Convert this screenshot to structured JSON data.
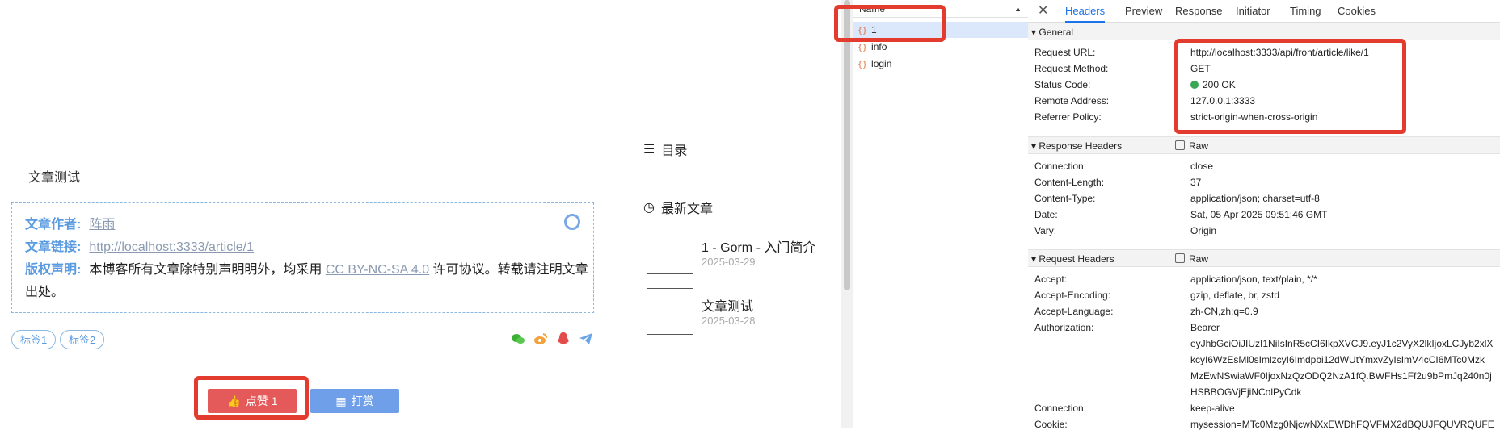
{
  "blog": {
    "article_title": "文章测试",
    "author_label": "文章作者:",
    "author_name": "阵雨",
    "link_label": "文章链接:",
    "link_url": "http://localhost:3333/article/1",
    "copyright_label": "版权声明:",
    "copyright_text_1": "本博客所有文章除特别声明明外，均采用",
    "license": "CC BY-NC-SA 4.0",
    "copyright_text_2": "许可协议。转载请注明文章",
    "copyright_text_3": "出处。",
    "tags": [
      "标签1",
      "标签2"
    ],
    "share_icons": [
      "wechat-icon",
      "weibo-icon",
      "qq-icon",
      "telegram-icon"
    ],
    "like_button": "点赞 1",
    "reward_button": "打赏"
  },
  "sidebar": {
    "toc_title": "目录",
    "recent_title": "最新文章",
    "recent_posts": [
      {
        "title": "1 - Gorm - 入门简介",
        "date": "2025-03-29"
      },
      {
        "title": "文章测试",
        "date": "2025-03-28"
      }
    ]
  },
  "devtools": {
    "list_header": "Name",
    "requests": [
      "1",
      "info",
      "login"
    ],
    "tabs": [
      "Headers",
      "Preview",
      "Response",
      "Initiator",
      "Timing",
      "Cookies"
    ],
    "general": {
      "title": "General",
      "rows": [
        {
          "k": "Request URL:",
          "v": "http://localhost:3333/api/front/article/like/1"
        },
        {
          "k": "Request Method:",
          "v": "GET"
        },
        {
          "k": "Status Code:",
          "v": "200 OK"
        },
        {
          "k": "Remote Address:",
          "v": "127.0.0.1:3333"
        },
        {
          "k": "Referrer Policy:",
          "v": "strict-origin-when-cross-origin"
        }
      ]
    },
    "response_headers": {
      "title": "Response Headers",
      "raw_label": "Raw",
      "rows": [
        {
          "k": "Connection:",
          "v": "close"
        },
        {
          "k": "Content-Length:",
          "v": "37"
        },
        {
          "k": "Content-Type:",
          "v": "application/json; charset=utf-8"
        },
        {
          "k": "Date:",
          "v": "Sat, 05 Apr 2025 09:51:46 GMT"
        },
        {
          "k": "Vary:",
          "v": "Origin"
        }
      ]
    },
    "request_headers": {
      "title": "Request Headers",
      "raw_label": "Raw",
      "rows": [
        {
          "k": "Accept:",
          "v": "application/json, text/plain, */*"
        },
        {
          "k": "Accept-Encoding:",
          "v": "gzip, deflate, br, zstd"
        },
        {
          "k": "Accept-Language:",
          "v": "zh-CN,zh;q=0.9"
        },
        {
          "k": "Authorization:",
          "v": "Bearer"
        }
      ],
      "auth_lines": [
        "eyJhbGciOiJIUzI1NiIsInR5cCI6IkpXVCJ9.eyJ1c2VyX2lkIjoxLCJyb2xlX",
        "kcyI6WzEsMl0sImlzcyI6Imdpbi12dWUtYmxvZyIsImV4cCI6MTc0Mzk",
        "MzEwNSwiaWF0IjoxNzQzODQ2NzA1fQ.BWFHs1Ff2u9bPmJq240n0j",
        "HSBBOGVjEjiNColPyCdk"
      ],
      "rows_after": [
        {
          "k": "Connection:",
          "v": "keep-alive"
        },
        {
          "k": "Cookie:",
          "v": "mysession=MTc0Mzg0NjcwNXxEWDhFQVFMX2dBQUJFQUVRQUFE"
        }
      ]
    }
  },
  "colors": {
    "accent": "#1a73e8",
    "highlight": "#e33b2e",
    "like": "#e45a5a",
    "reward": "#6f9fe8",
    "status_ok": "#3aa757"
  }
}
